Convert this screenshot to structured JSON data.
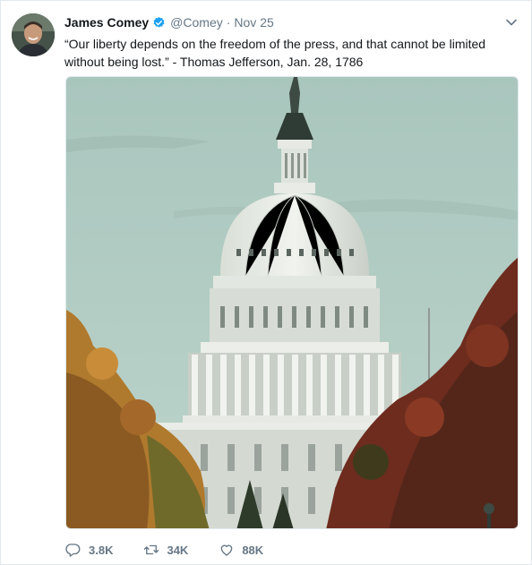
{
  "tweet": {
    "name": "James Comey",
    "handle": "@Comey",
    "separator": "·",
    "date": "Nov 25",
    "text": "“Our liberty depends on the freedom of the press, and that cannot be limited without being lost.” - Thomas Jefferson,  Jan. 28, 1786",
    "media_description_icon": "photo-capitol-dome",
    "actions": {
      "reply_count": "3.8K",
      "retweet_count": "34K",
      "like_count": "88K"
    }
  },
  "icons": {
    "verified": "verified-badge-icon",
    "caret": "chevron-down-icon",
    "reply": "reply-icon",
    "retweet": "retweet-icon",
    "like": "heart-icon"
  },
  "colors": {
    "verified": "#1da1f2",
    "secondary_text": "#657786",
    "border": "#e1e8ed"
  }
}
